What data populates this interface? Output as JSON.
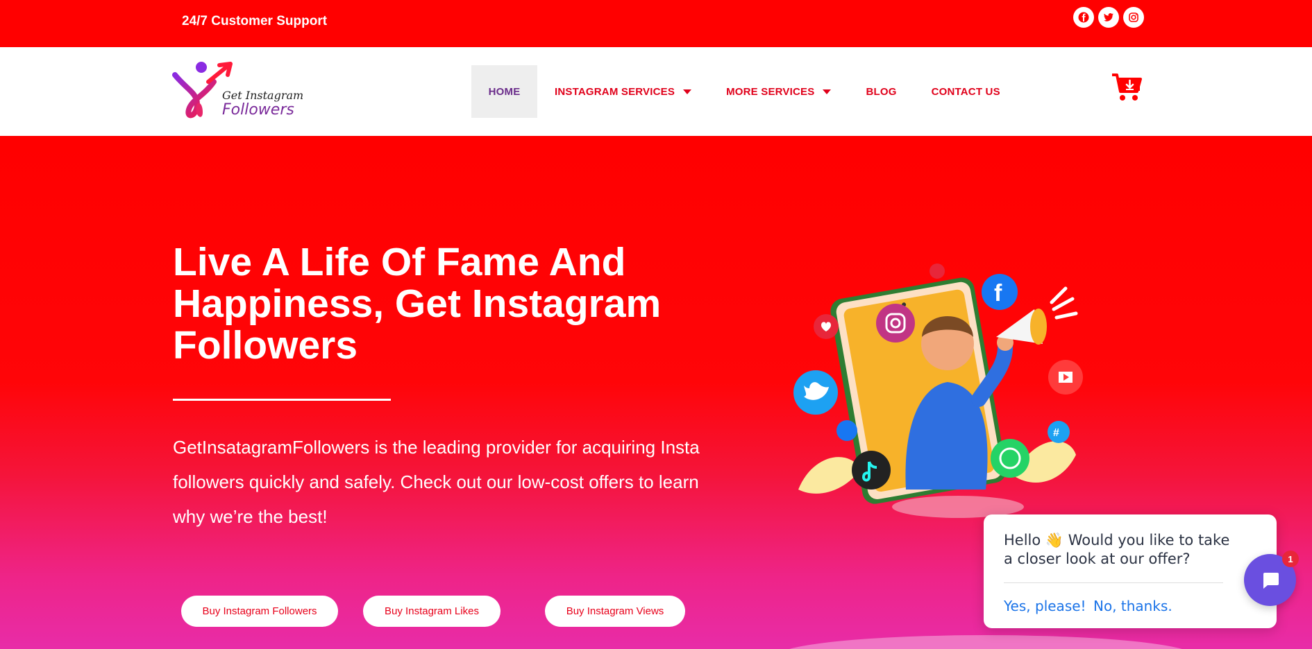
{
  "topbar": {
    "support_text": "24/7 Customer Support",
    "socials": [
      {
        "name": "facebook-icon"
      },
      {
        "name": "twitter-icon"
      },
      {
        "name": "instagram-icon"
      }
    ]
  },
  "header": {
    "logo": {
      "line1": "Get Instagram",
      "line2": "Followers"
    },
    "nav": {
      "home": "HOME",
      "instagram_services": "INSTAGRAM SERVICES",
      "more_services": "MORE SERVICES",
      "blog": "BLOG",
      "contact": "CONTACT US"
    },
    "cart_icon": "cart-download-icon"
  },
  "hero": {
    "title": "Live A Life Of Fame And Happiness, Get Instagram Followers",
    "description": "GetInsatagramFollowers is the leading provider for acquiring Insta followers quickly and safely. Check out our low-cost offers to learn why we’re the best!",
    "buttons": {
      "followers": "Buy Instagram Followers",
      "likes": "Buy Instagram Likes",
      "views": "Buy Instagram Views"
    }
  },
  "chat": {
    "message": "Hello 👋 Would you like to take a closer look at our offer?",
    "yes": "Yes, please!",
    "no": "No, thanks.",
    "badge": "1"
  },
  "colors": {
    "brand_red": "#ff0000",
    "nav_text": "#e0001a",
    "home_text": "#6a2c8a",
    "chat_button": "#6a4fe0",
    "link_blue": "#1a73e8"
  }
}
